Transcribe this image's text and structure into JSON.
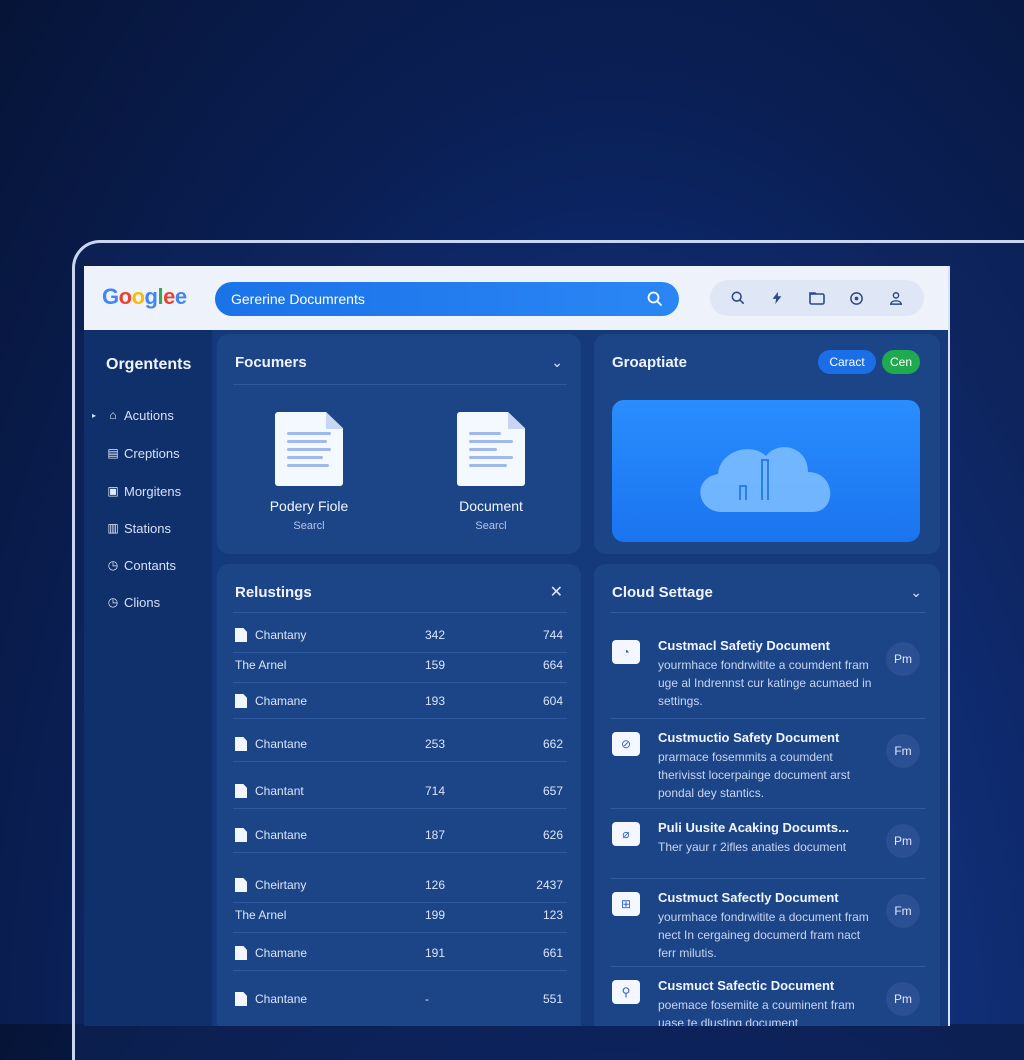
{
  "header": {
    "logo": "Googlee",
    "search_value": "Gererine Documrents",
    "tool_icons": [
      "search-icon",
      "bolt-icon",
      "folder-icon",
      "settings-icon",
      "user-icon"
    ]
  },
  "sidebar": {
    "title": "Orgentents",
    "items": [
      {
        "label": "Acutions",
        "icon": "building-icon"
      },
      {
        "label": "Creptions",
        "icon": "card-icon"
      },
      {
        "label": "Morgitens",
        "icon": "image-icon"
      },
      {
        "label": "Stations",
        "icon": "chart-icon"
      },
      {
        "label": "Contants",
        "icon": "clock-icon"
      },
      {
        "label": "Clions",
        "icon": "clock-icon"
      }
    ]
  },
  "documents_panel": {
    "title": "Focumers",
    "tiles": [
      {
        "name": "Podery Fiole",
        "sub": "Searcl"
      },
      {
        "name": "Document",
        "sub": "Searcl"
      }
    ]
  },
  "graph_panel": {
    "title": "Groaptiate",
    "button_cancel": "Caract",
    "button_ok": "Cen"
  },
  "results_panel": {
    "title": "Relustings",
    "rows": [
      {
        "name": "Chantany",
        "v1": "342",
        "v2": "744",
        "doc": true
      },
      {
        "name": "The Arnel",
        "v1": "159",
        "v2": "664",
        "doc": false
      },
      {
        "name": "Chamane",
        "v1": "193",
        "v2": "604",
        "doc": true
      },
      {
        "name": "Chantane",
        "v1": "253",
        "v2": "662",
        "doc": true
      },
      {
        "name": "Chantant",
        "v1": "714",
        "v2": "657",
        "doc": true
      },
      {
        "name": "Chantane",
        "v1": "187",
        "v2": "626",
        "doc": true
      },
      {
        "name": "Cheirtany",
        "v1": "126",
        "v2": "2437",
        "doc": true
      },
      {
        "name": "The Arnel",
        "v1": "199",
        "v2": "123",
        "doc": false
      },
      {
        "name": "Chamane",
        "v1": "191",
        "v2": "661",
        "doc": true
      },
      {
        "name": "Chantane",
        "v1": "-",
        "v2": "551",
        "doc": true
      }
    ]
  },
  "cloud_panel": {
    "title": "Cloud Settage",
    "items": [
      {
        "title": "Custmacl Safetiy Document",
        "desc": "yourmhace fondrwitite a coumdent fram uge al Indrennst cur katinge acumaed in settings.",
        "badge": "Pm"
      },
      {
        "title": "Custmuctio Safety Document",
        "desc": "prarmace fosemmits a coumdent therivisst locerpainge document arst pondal dey stantics.",
        "badge": "Fm"
      },
      {
        "title": "Puli Uusite Acaking Documts...",
        "desc": "Ther yaur r 2ifles anaties document",
        "badge": "Pm"
      },
      {
        "title": "Custmuct Safectly Document",
        "desc": "yourmhace fondrwitite a document fram nect In cergaineg documerd fram nact ferr milutis.",
        "badge": "Fm"
      },
      {
        "title": "Cusmuct Safectic Document",
        "desc": "poemace fosemiite a couminent fram uase te dlusting document",
        "badge": "Pm"
      }
    ]
  }
}
